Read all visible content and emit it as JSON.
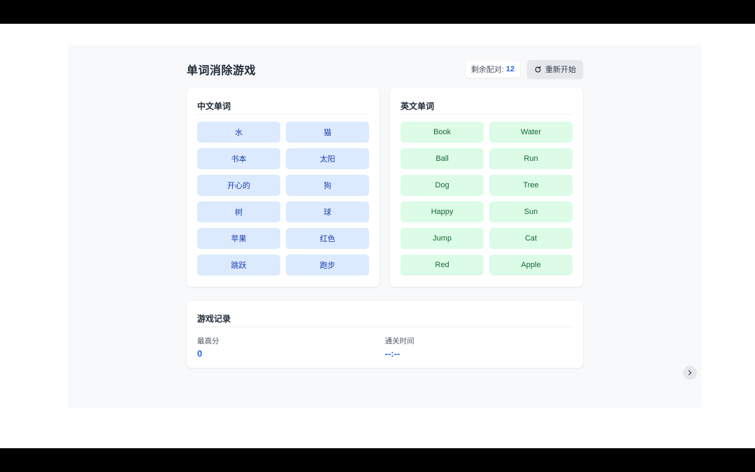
{
  "header": {
    "title": "单词消除游戏",
    "remaining_label": "剩余配对:",
    "remaining_count": "12",
    "restart_label": "重新开始"
  },
  "chinese_panel": {
    "title": "中文单词",
    "words": [
      "水",
      "猫",
      "书本",
      "太阳",
      "开心的",
      "狗",
      "树",
      "球",
      "苹果",
      "红色",
      "跳跃",
      "跑步"
    ]
  },
  "english_panel": {
    "title": "英文单词",
    "words": [
      "Book",
      "Water",
      "Ball",
      "Run",
      "Dog",
      "Tree",
      "Happy",
      "Sun",
      "Jump",
      "Cat",
      "Red",
      "Apple"
    ]
  },
  "record": {
    "title": "游戏记录",
    "high_score_label": "最高分",
    "high_score_value": "0",
    "clear_time_label": "通关时间",
    "clear_time_value": "--:--"
  },
  "icons": {
    "restart": "refresh-icon",
    "next": "chevron-right-icon"
  },
  "colors": {
    "accent": "#2563eb",
    "chinese_card_bg": "#dbeafe",
    "english_card_bg": "#dcfce7"
  }
}
